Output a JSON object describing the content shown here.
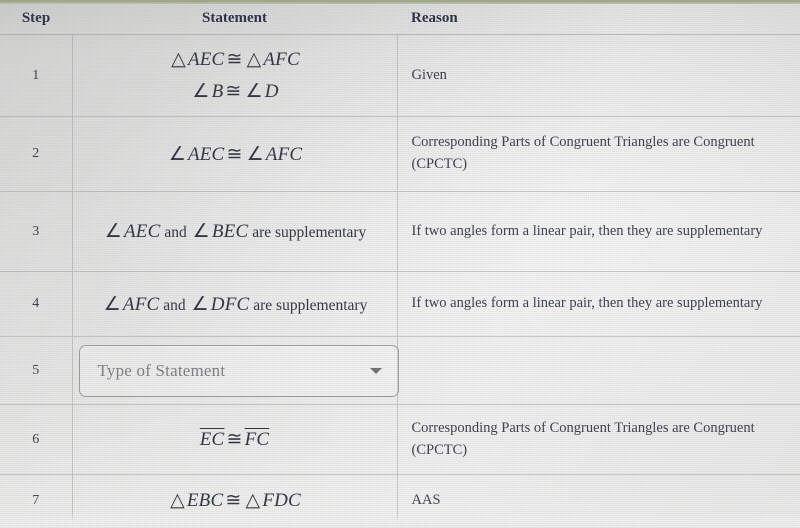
{
  "table": {
    "headers": {
      "step": "Step",
      "statement": "Statement",
      "reason": "Reason"
    },
    "rows": [
      {
        "step": "1",
        "statement_lines": [
          {
            "parts": [
              {
                "t": "sym",
                "v": "△"
              },
              {
                "t": "ital",
                "v": "AEC"
              },
              {
                "t": "sym",
                "v": "≅"
              },
              {
                "t": "sym",
                "v": "△"
              },
              {
                "t": "ital",
                "v": "AFC"
              }
            ]
          },
          {
            "parts": [
              {
                "t": "sym",
                "v": "∠"
              },
              {
                "t": "ital",
                "v": "B"
              },
              {
                "t": "sym",
                "v": "≅"
              },
              {
                "t": "sym",
                "v": "∠"
              },
              {
                "t": "ital",
                "v": "D"
              }
            ]
          }
        ],
        "reason": "Given"
      },
      {
        "step": "2",
        "statement_lines": [
          {
            "parts": [
              {
                "t": "sym",
                "v": "∠"
              },
              {
                "t": "ital",
                "v": "AEC"
              },
              {
                "t": "sym",
                "v": "≅"
              },
              {
                "t": "sym",
                "v": "∠"
              },
              {
                "t": "ital",
                "v": "AFC"
              }
            ]
          }
        ],
        "reason": "Corresponding Parts of Congruent Triangles are Congruent (CPCTC)"
      },
      {
        "step": "3",
        "statement_lines": [
          {
            "parts": [
              {
                "t": "sym",
                "v": "∠"
              },
              {
                "t": "ital",
                "v": "AEC"
              },
              {
                "t": "word",
                "v": "and"
              },
              {
                "t": "sym",
                "v": "∠"
              },
              {
                "t": "ital",
                "v": "BEC"
              },
              {
                "t": "word",
                "v": "are supplementary"
              }
            ]
          }
        ],
        "reason": "If two angles form a linear pair, then they are supplementary"
      },
      {
        "step": "4",
        "statement_lines": [
          {
            "parts": [
              {
                "t": "sym",
                "v": "∠"
              },
              {
                "t": "ital",
                "v": "AFC"
              },
              {
                "t": "word",
                "v": "and"
              },
              {
                "t": "sym",
                "v": "∠"
              },
              {
                "t": "ital",
                "v": "DFC"
              },
              {
                "t": "word",
                "v": "are supplementary"
              }
            ]
          }
        ],
        "reason": "If two angles form a linear pair, then they are supplementary"
      },
      {
        "step": "5",
        "control": "select",
        "select_placeholder": "Type of Statement",
        "select_icon": "chevron-down-icon",
        "statement_lines": [],
        "reason": ""
      },
      {
        "step": "6",
        "statement_lines": [
          {
            "parts": [
              {
                "t": "seg",
                "v": "EC"
              },
              {
                "t": "sym",
                "v": "≅"
              },
              {
                "t": "seg",
                "v": "FC"
              }
            ]
          }
        ],
        "reason": "Corresponding Parts of Congruent Triangles are Congruent (CPCTC)"
      },
      {
        "step": "7",
        "statement_lines": [
          {
            "parts": [
              {
                "t": "sym",
                "v": "△"
              },
              {
                "t": "ital",
                "v": "EBC"
              },
              {
                "t": "sym",
                "v": "≅"
              },
              {
                "t": "sym",
                "v": "△"
              },
              {
                "t": "ital",
                "v": "FDC"
              }
            ]
          }
        ],
        "reason": "AAS"
      }
    ]
  },
  "colors": {
    "header_text": "#2b3147",
    "body_text": "#3a4050",
    "placeholder_text": "#7c8083",
    "grid_line": "#969a98",
    "page_background": "#dcdddb",
    "top_strip": "#9aa583"
  }
}
